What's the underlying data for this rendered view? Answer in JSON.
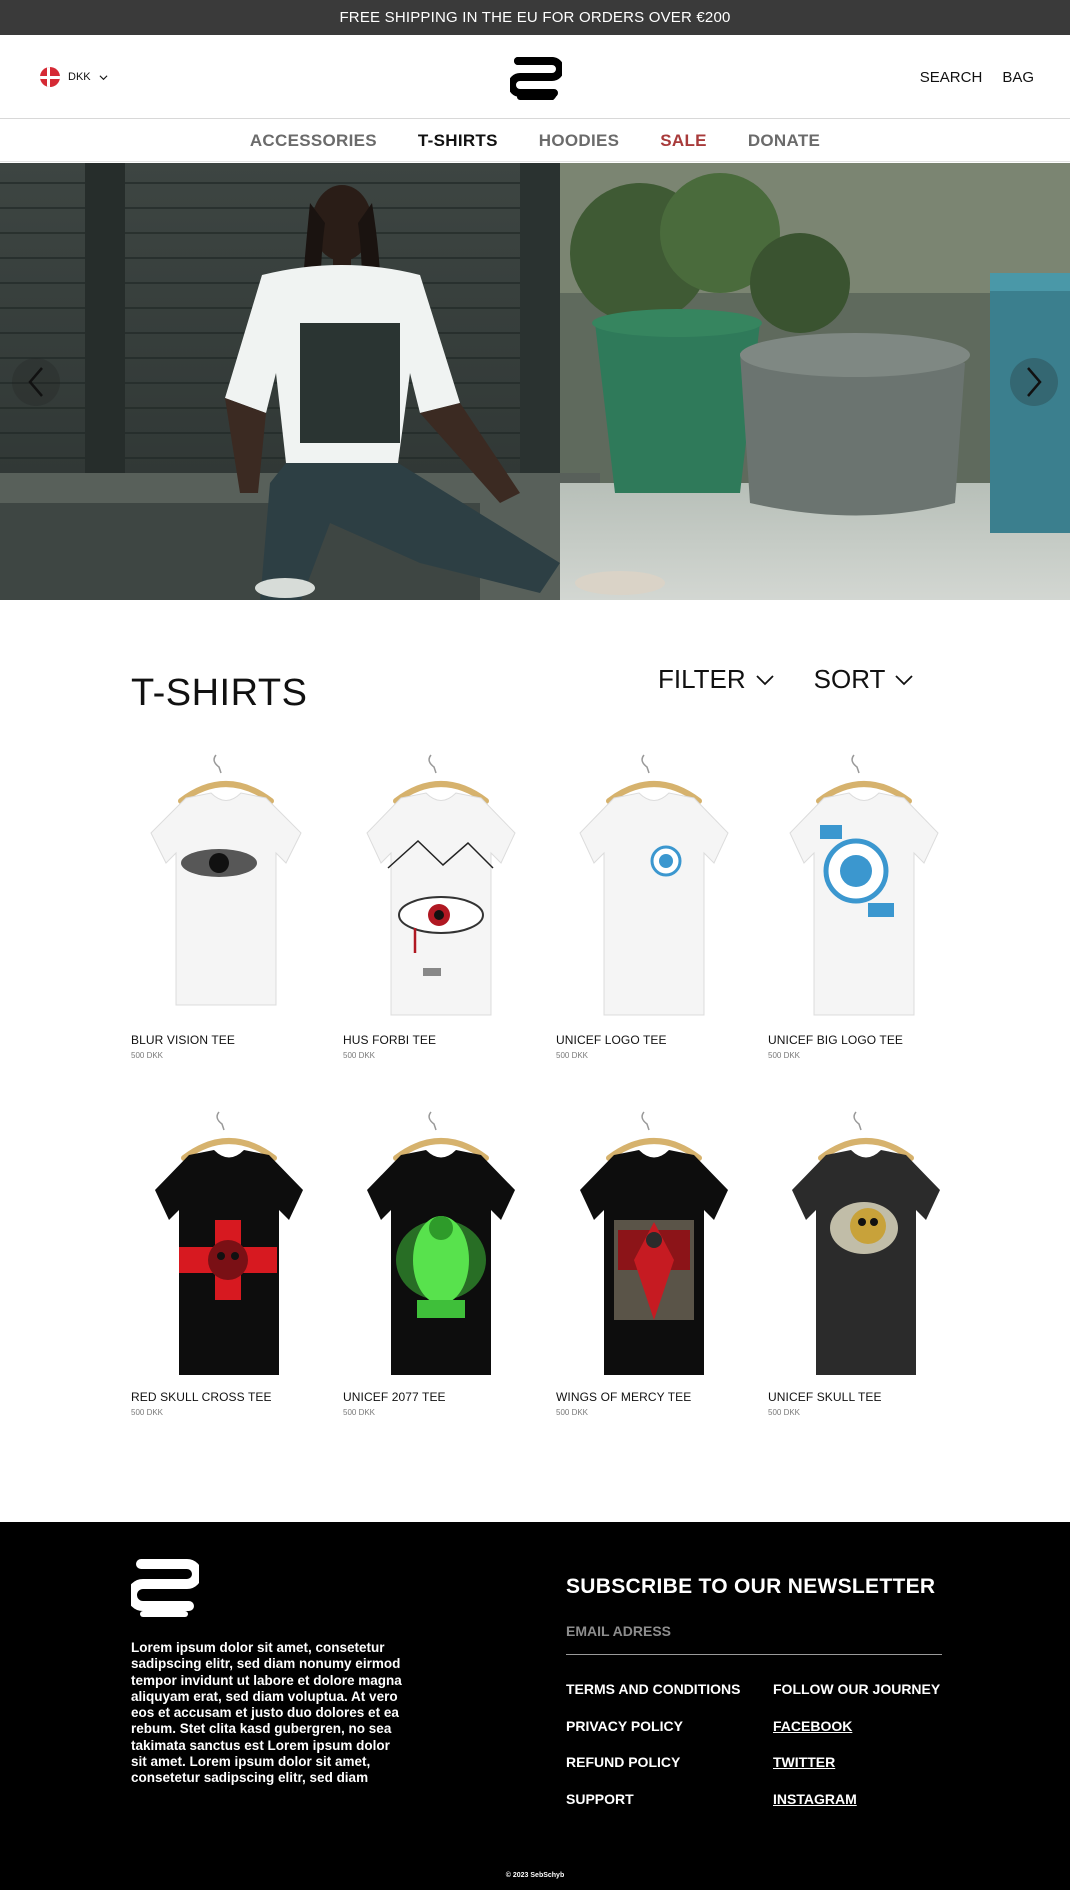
{
  "announcement": "FREE SHIPPING IN THE EU FOR ORDERS OVER €200",
  "header": {
    "currency": "DKK",
    "search_label": "SEARCH",
    "bag_label": "BAG"
  },
  "nav": {
    "items": [
      {
        "label": "ACCESSORIES",
        "state": "normal"
      },
      {
        "label": "T-SHIRTS",
        "state": "active"
      },
      {
        "label": "HOODIES",
        "state": "normal"
      },
      {
        "label": "SALE",
        "state": "sale"
      },
      {
        "label": "DONATE",
        "state": "normal"
      }
    ]
  },
  "listing": {
    "title": "T-SHIRTS",
    "filter_label": "FILTER",
    "sort_label": "SORT",
    "products": [
      {
        "name": "BLUR VISION TEE",
        "price": "500 DKK",
        "shirt": "white",
        "print": "eye-blur"
      },
      {
        "name": "HUS FORBI TEE",
        "price": "500 DKK",
        "shirt": "white",
        "print": "eye-red"
      },
      {
        "name": "UNICEF LOGO TEE",
        "price": "500 DKK",
        "shirt": "white",
        "print": "logo-small"
      },
      {
        "name": "UNICEF BIG LOGO TEE",
        "price": "500 DKK",
        "shirt": "white",
        "print": "logo-big"
      },
      {
        "name": "RED SKULL CROSS TEE",
        "price": "500 DKK",
        "shirt": "black",
        "print": "red-cross-skull"
      },
      {
        "name": "UNICEF 2077 TEE",
        "price": "500 DKK",
        "shirt": "black",
        "print": "green-figure"
      },
      {
        "name": "WINGS OF MERCY TEE",
        "price": "500 DKK",
        "shirt": "black",
        "print": "red-wings"
      },
      {
        "name": "UNICEF SKULL TEE",
        "price": "500 DKK",
        "shirt": "charcoal",
        "print": "gold-skull"
      }
    ]
  },
  "footer": {
    "about": "Lorem ipsum dolor sit amet, consetetur sadipscing elitr, sed diam nonumy eirmod tempor invidunt ut labore et dolore magna aliquyam erat, sed diam voluptua. At vero eos et accusam et justo duo dolores et ea rebum. Stet clita kasd gubergren, no sea takimata sanctus est Lorem ipsum dolor sit amet. Lorem ipsum dolor sit amet, consetetur sadipscing elitr, sed diam",
    "newsletter_title": "SUBSCRIBE TO OUR NEWSLETTER",
    "email_placeholder": "EMAIL ADRESS",
    "policies": [
      "TERMS AND CONDITIONS",
      "PRIVACY POLICY",
      "REFUND POLICY",
      "SUPPORT"
    ],
    "follow_title": "FOLLOW OUR JOURNEY",
    "social": [
      "FACEBOOK",
      "TWITTER",
      "INSTAGRAM"
    ],
    "copyright": "© 2023 SebSchyb"
  },
  "colors": {
    "topbar": "#3a3a3a",
    "sale": "#a83a3a",
    "footer": "#000000"
  }
}
